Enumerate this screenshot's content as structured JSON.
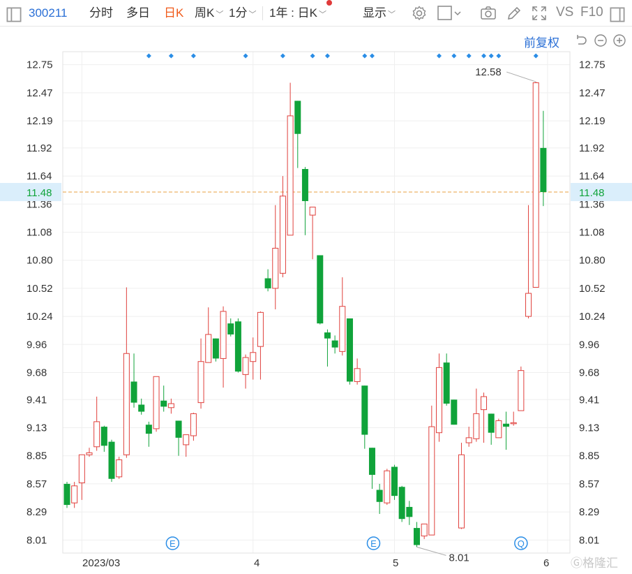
{
  "toolbar": {
    "code": "300211",
    "tab_fenshi": "分时",
    "tab_duori": "多日",
    "tab_rik": "日K",
    "tab_zhouk": "周K",
    "tab_1fen": "1分",
    "period": "1年 : 日K",
    "display": "显示",
    "vs": "VS",
    "f10": "F10"
  },
  "subbar": {
    "adjust": "前复权"
  },
  "watermark": "格隆汇",
  "colors": {
    "up": "#e0403c",
    "down": "#10a33a",
    "current_line": "#e8a040",
    "current_bg": "#daeefb",
    "current_text": "#10a33a",
    "accent": "#2a6fd6",
    "marker": "#2a8de6"
  },
  "chart_data": {
    "type": "candlestick",
    "ylim": [
      7.88,
      12.88
    ],
    "y_ticks": [
      "12.75",
      "12.47",
      "12.19",
      "11.92",
      "11.64",
      "11.36",
      "11.08",
      "10.80",
      "10.52",
      "10.24",
      "9.96",
      "9.68",
      "9.41",
      "9.13",
      "8.85",
      "8.57",
      "8.29",
      "8.01"
    ],
    "x_labels": [
      "2023/03",
      "4",
      "5",
      "6"
    ],
    "current_price": "11.48",
    "high_label": "12.58",
    "low_label": "8.01",
    "event_markers": [
      "E",
      "E",
      "Q"
    ],
    "candles": [
      [
        8.57,
        8.36,
        8.59,
        8.33
      ],
      [
        8.38,
        8.55,
        8.59,
        8.33
      ],
      [
        8.58,
        8.86,
        8.86,
        8.41
      ],
      [
        8.86,
        8.88,
        8.93,
        8.84
      ],
      [
        8.94,
        9.19,
        9.44,
        8.9
      ],
      [
        9.14,
        8.95,
        9.15,
        8.89
      ],
      [
        8.99,
        8.62,
        9.01,
        8.59
      ],
      [
        8.64,
        8.81,
        8.84,
        8.62
      ],
      [
        8.86,
        9.87,
        10.53,
        8.83
      ],
      [
        9.59,
        9.38,
        9.87,
        9.33
      ],
      [
        9.36,
        9.29,
        9.42,
        9.26
      ],
      [
        9.16,
        9.07,
        9.19,
        8.94
      ],
      [
        9.12,
        9.64,
        9.64,
        9.09
      ],
      [
        9.4,
        9.34,
        9.55,
        9.29
      ],
      [
        9.33,
        9.37,
        9.42,
        9.27
      ],
      [
        9.2,
        9.03,
        9.2,
        8.85
      ],
      [
        8.96,
        9.06,
        9.06,
        8.84
      ],
      [
        9.05,
        9.27,
        9.28,
        9.0
      ],
      [
        9.38,
        9.79,
        10.02,
        9.32
      ],
      [
        9.78,
        10.06,
        10.33,
        9.78
      ],
      [
        10.02,
        9.82,
        10.02,
        9.79
      ],
      [
        9.82,
        10.29,
        10.34,
        9.53
      ],
      [
        10.17,
        10.06,
        10.22,
        10.04
      ],
      [
        10.19,
        9.69,
        10.22,
        9.68
      ],
      [
        9.66,
        9.83,
        9.86,
        9.52
      ],
      [
        9.79,
        9.88,
        10.03,
        9.61
      ],
      [
        9.94,
        10.28,
        10.29,
        9.61
      ],
      [
        10.62,
        10.52,
        10.71,
        10.49
      ],
      [
        10.52,
        10.92,
        11.35,
        10.31
      ],
      [
        10.67,
        11.44,
        11.64,
        10.63
      ],
      [
        11.05,
        12.24,
        12.57,
        11.05
      ],
      [
        12.39,
        12.06,
        12.39,
        11.72
      ],
      [
        11.71,
        11.39,
        11.73,
        11.05
      ],
      [
        11.25,
        11.33,
        11.33,
        10.81
      ],
      [
        10.85,
        10.17,
        10.85,
        10.16
      ],
      [
        10.08,
        10.02,
        10.11,
        9.74
      ],
      [
        10.0,
        9.93,
        10.05,
        9.87
      ],
      [
        9.89,
        10.34,
        10.63,
        9.85
      ],
      [
        10.22,
        9.59,
        10.22,
        9.56
      ],
      [
        9.59,
        9.72,
        9.82,
        9.56
      ],
      [
        9.55,
        9.06,
        9.55,
        8.92
      ],
      [
        8.93,
        8.66,
        8.93,
        8.52
      ],
      [
        8.51,
        8.39,
        8.57,
        8.27
      ],
      [
        8.38,
        8.7,
        8.72,
        8.36
      ],
      [
        8.74,
        8.45,
        8.76,
        8.41
      ],
      [
        8.54,
        8.22,
        8.55,
        8.19
      ],
      [
        8.34,
        8.24,
        8.4,
        8.16
      ],
      [
        8.13,
        7.96,
        8.19,
        7.94
      ],
      [
        8.05,
        8.17,
        8.17,
        8.02
      ],
      [
        8.06,
        9.14,
        9.35,
        8.06
      ],
      [
        9.08,
        9.73,
        9.87,
        8.99
      ],
      [
        9.78,
        9.37,
        9.87,
        9.35
      ],
      [
        9.41,
        9.16,
        9.41,
        9.16
      ],
      [
        8.13,
        8.86,
        8.98,
        8.12
      ],
      [
        8.98,
        9.03,
        9.14,
        8.94
      ],
      [
        9.02,
        9.27,
        9.52,
        8.99
      ],
      [
        9.31,
        9.44,
        9.48,
        8.98
      ],
      [
        9.27,
        9.08,
        9.27,
        8.96
      ],
      [
        9.03,
        9.2,
        9.22,
        9.03
      ],
      [
        9.17,
        9.14,
        9.29,
        8.91
      ],
      [
        9.17,
        9.18,
        9.29,
        9.15
      ],
      [
        9.3,
        9.7,
        9.74,
        9.31
      ],
      [
        10.24,
        10.47,
        11.35,
        10.22
      ],
      [
        10.53,
        12.57,
        12.58,
        10.53
      ],
      [
        11.92,
        11.48,
        12.29,
        11.34
      ]
    ],
    "blue_markers": [
      11,
      14,
      17,
      24,
      29,
      33,
      35,
      40,
      41,
      50,
      52,
      54,
      56,
      57,
      58,
      63
    ]
  }
}
